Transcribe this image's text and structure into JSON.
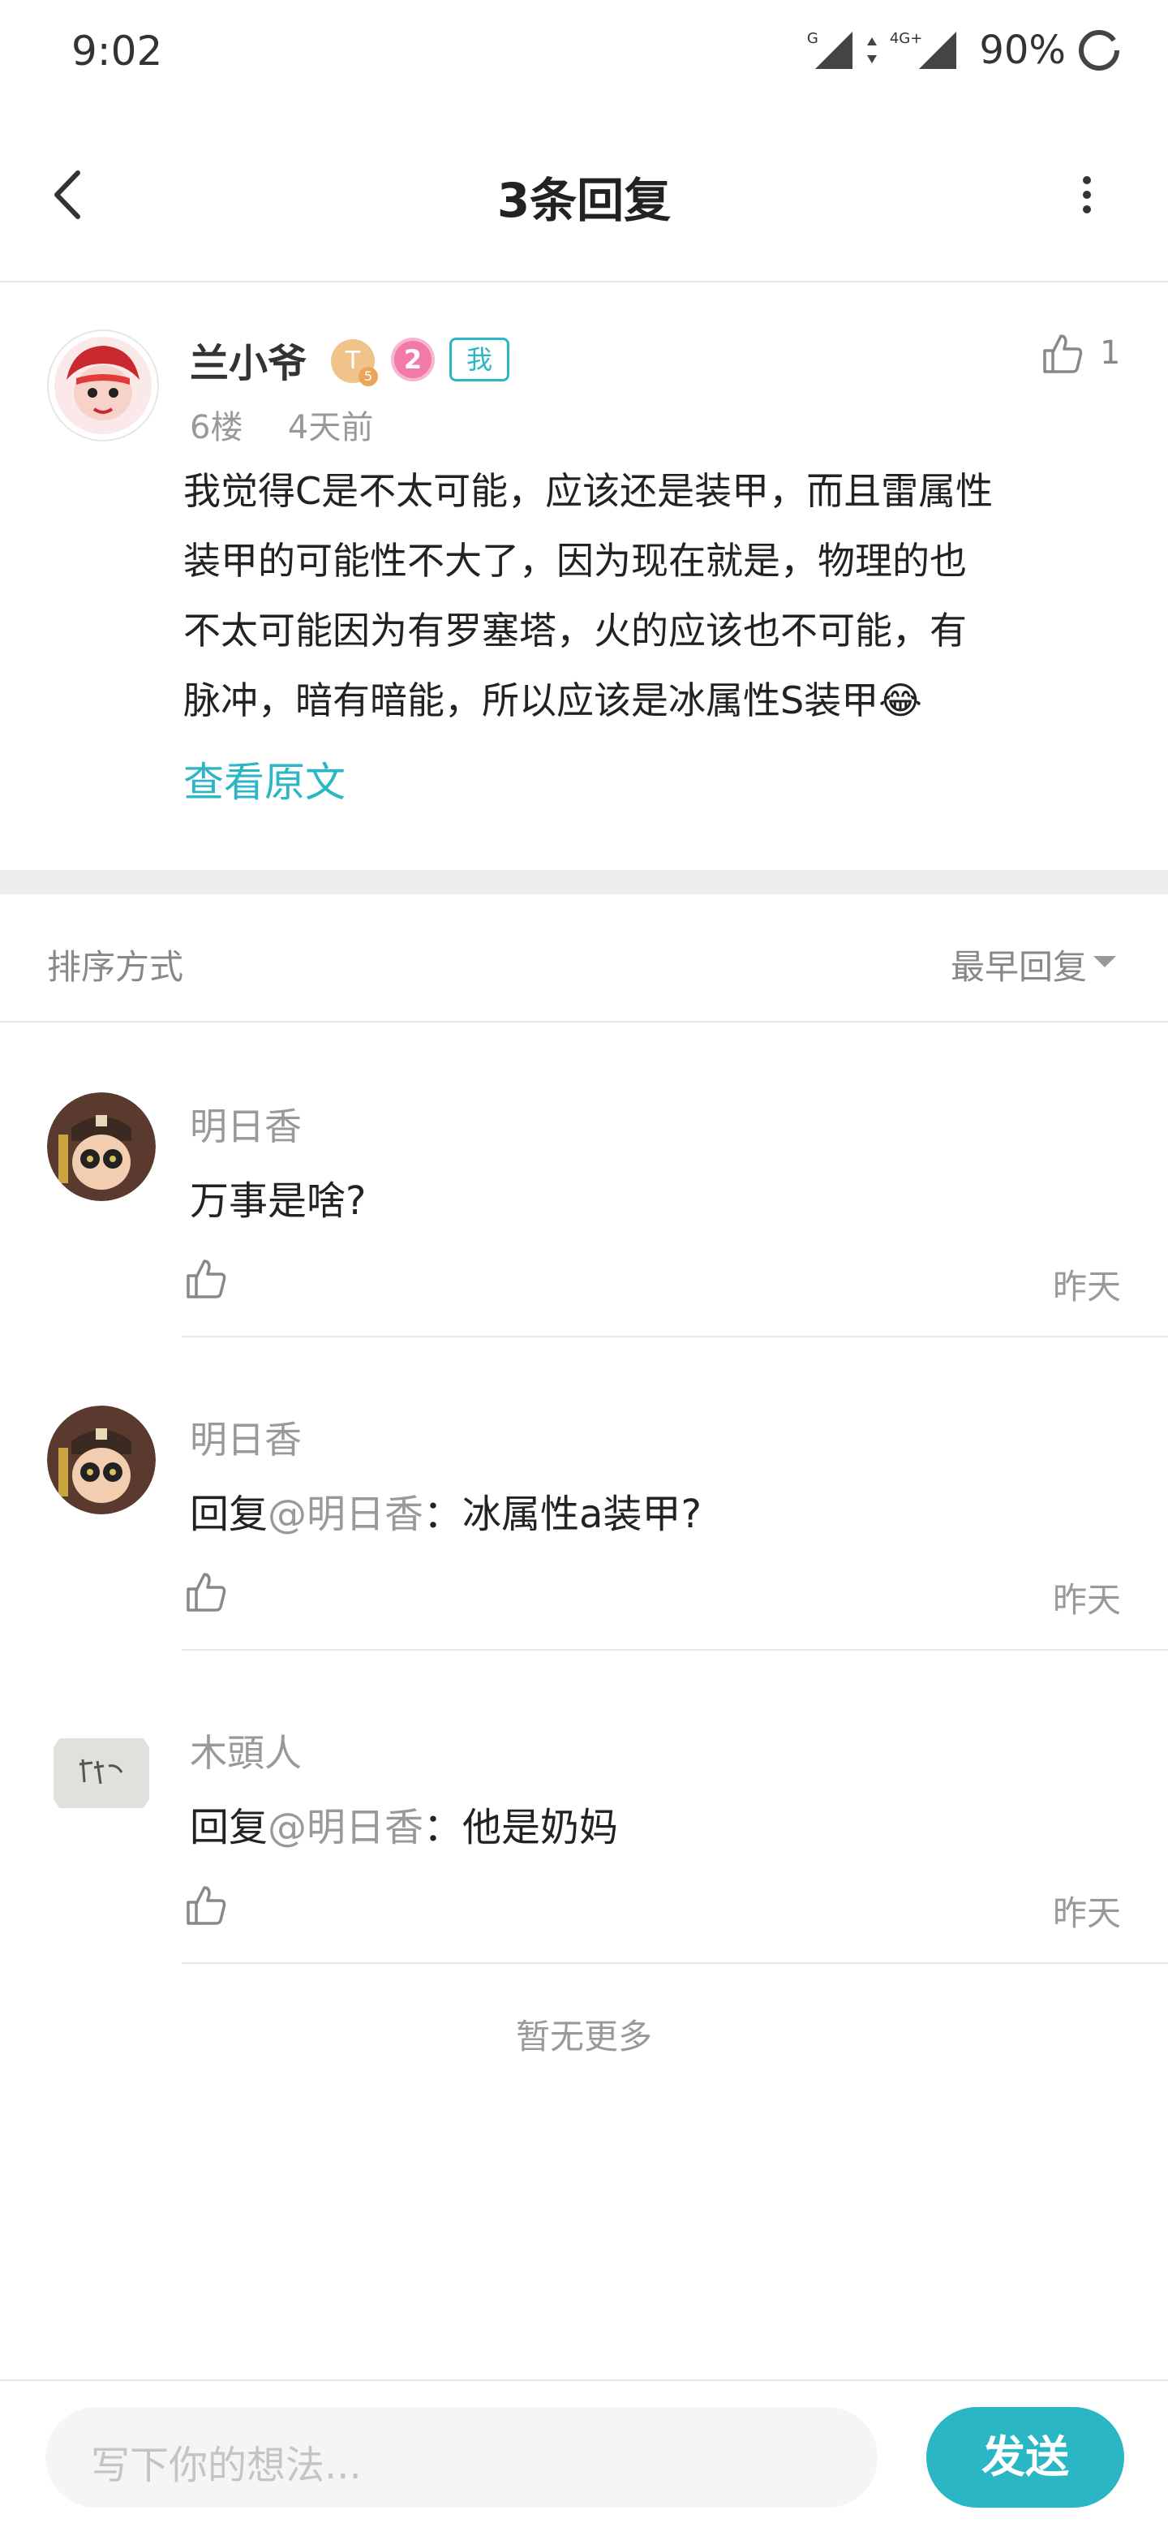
{
  "status_bar": {
    "time": "9:02",
    "signal_1_label": "G",
    "signal_2_label": "4G+",
    "battery": "90%"
  },
  "header": {
    "title": "3条回复",
    "back_icon": "chevron-left-icon",
    "more_icon": "more-vertical-icon"
  },
  "original_post": {
    "author": "兰小爷",
    "badge_t": "T",
    "badge_t_level": "5",
    "badge_level": "2",
    "badge_me": "我",
    "like_count": "1",
    "floor": "6楼",
    "time": "4天前",
    "lines": [
      "我觉得C是不太可能，应该还是装甲，而且雷属性",
      "装甲的可能性不大了，因为现在就是，物理的也",
      "不太可能因为有罗塞塔，火的应该也不可能，有",
      "脉冲，暗有暗能，所以应该是冰属性S装甲😂"
    ],
    "view_original": "查看原文"
  },
  "sort": {
    "label": "排序方式",
    "value": "最早回复"
  },
  "replies": [
    {
      "author": "明日香",
      "prefix": "",
      "mention": "",
      "text": "万事是啥?",
      "time": "昨天"
    },
    {
      "author": "明日香",
      "prefix": "回复",
      "mention": "@明日香",
      "text": "：冰属性a装甲?",
      "time": "昨天"
    },
    {
      "author": "木頭人",
      "prefix": "回复",
      "mention": "@明日香",
      "text": "：他是奶妈",
      "time": "昨天"
    }
  ],
  "no_more": "暂无更多",
  "composer": {
    "placeholder": "写下你的想法...",
    "send": "发送"
  },
  "colors": {
    "accent": "#2ab6c4",
    "text_primary": "#222222",
    "text_secondary": "#999999"
  }
}
